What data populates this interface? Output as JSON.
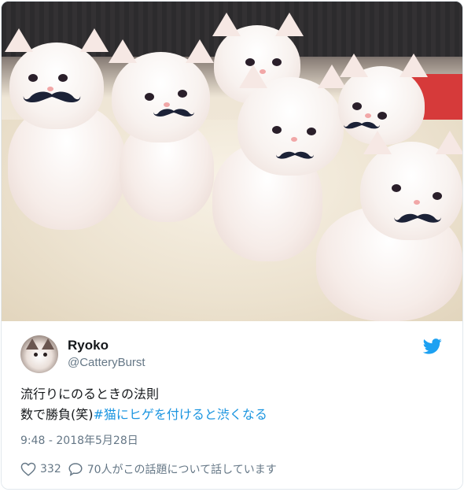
{
  "tweet": {
    "user_name": "Ryoko",
    "user_handle": "@CatteryBurst",
    "text_line1": "流行りにのるときの法則",
    "text_line2_prefix": "数で勝負(笑)",
    "hashtag": "#猫にヒゲを付けると渋くなる",
    "timestamp": "9:48 - 2018年5月28日",
    "like_count": "332",
    "conversation_text": "70人がこの話題について話しています"
  },
  "icons": {
    "brand": "twitter-bird-icon",
    "like": "heart-icon",
    "reply": "speech-bubble-icon"
  },
  "colors": {
    "link_blue": "#1b95e0",
    "secondary_text": "#657786",
    "twitter_blue": "#1da1f2"
  }
}
